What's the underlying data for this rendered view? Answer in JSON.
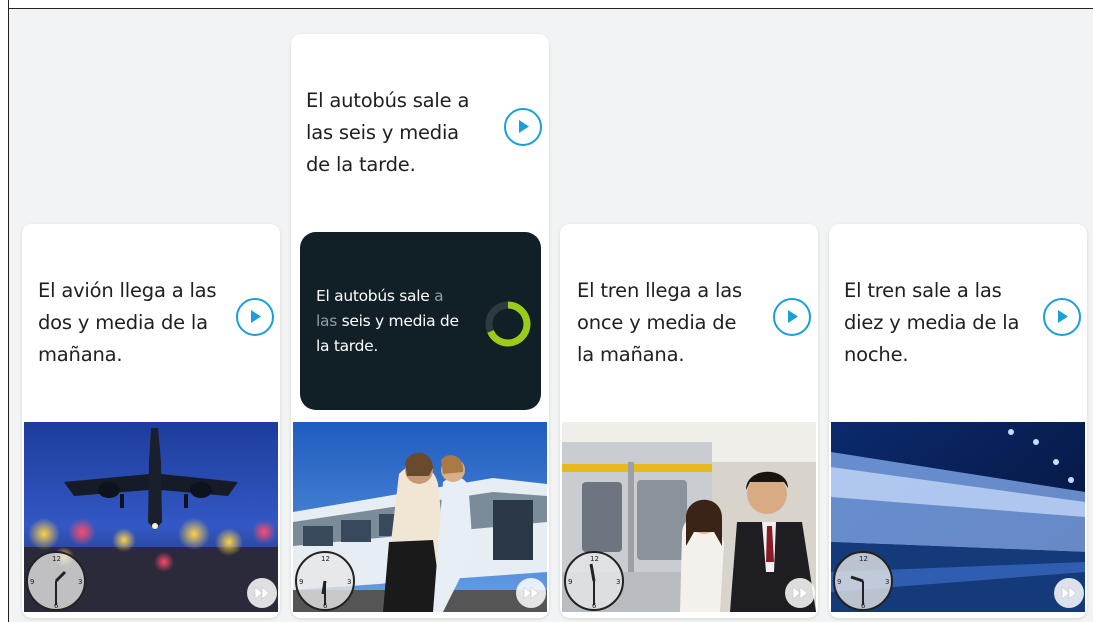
{
  "cards": [
    {
      "text": "El avión llega a las dos y media de la mañana.",
      "lines": [
        "El avión llega a las",
        "dos y media de la",
        "mañana."
      ],
      "play_icon": "play-circle-icon",
      "clock_icon": "clock-icon",
      "ff_icon": "fast-forward-icon"
    },
    {
      "text": "El autobús sale a las seis y media de la tarde.",
      "lines": [
        "El autobús sale a",
        "las seis y media",
        "de la tarde."
      ],
      "play_icon": "play-circle-icon",
      "clock_icon": "clock-icon",
      "ff_icon": "fast-forward-icon",
      "speech": {
        "spoken_1": "El autobús sale",
        "pending_1": " a",
        "pending_2": "las",
        "spoken_2": " seis y media de",
        "spoken_3": "la tarde."
      }
    },
    {
      "text": "El tren llega a las once y media de la mañana.",
      "lines": [
        "El tren llega a las",
        "once y media de",
        "la mañana."
      ],
      "play_icon": "play-circle-icon",
      "clock_icon": "clock-icon",
      "ff_icon": "fast-forward-icon"
    },
    {
      "text": "El tren sale a las diez y media de la noche.",
      "lines": [
        "El tren sale a las",
        "diez y media de la",
        "noche."
      ],
      "play_icon": "play-circle-icon",
      "clock_icon": "clock-icon",
      "ff_icon": "fast-forward-icon"
    }
  ],
  "colors": {
    "accent": "#1a9fd9",
    "dark_panel": "#111f26",
    "spinner": "#9ccc1a"
  }
}
